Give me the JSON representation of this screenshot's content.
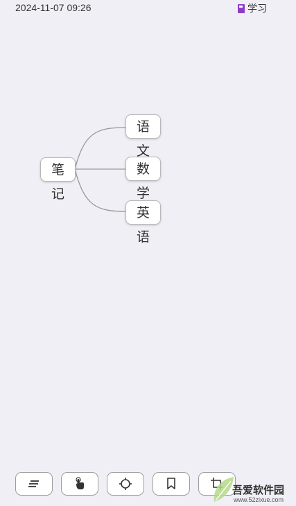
{
  "status_bar": {
    "datetime": "2024-11-07 09:26"
  },
  "notebook": {
    "label": "学习",
    "icon": "notebook-icon",
    "color": "#8e3bc6"
  },
  "mindmap": {
    "root": {
      "label": "笔记"
    },
    "children": [
      {
        "label": "语文"
      },
      {
        "label": "数学"
      },
      {
        "label": "英语"
      }
    ]
  },
  "toolbar": {
    "buttons": [
      {
        "icon": "outline-icon"
      },
      {
        "icon": "touch-hand-icon"
      },
      {
        "icon": "locate-center-icon"
      },
      {
        "icon": "bookmark-icon"
      },
      {
        "icon": "crop-icon"
      }
    ]
  },
  "watermark": {
    "text": "吾爱软件园",
    "url": "www.52zixue.com"
  }
}
